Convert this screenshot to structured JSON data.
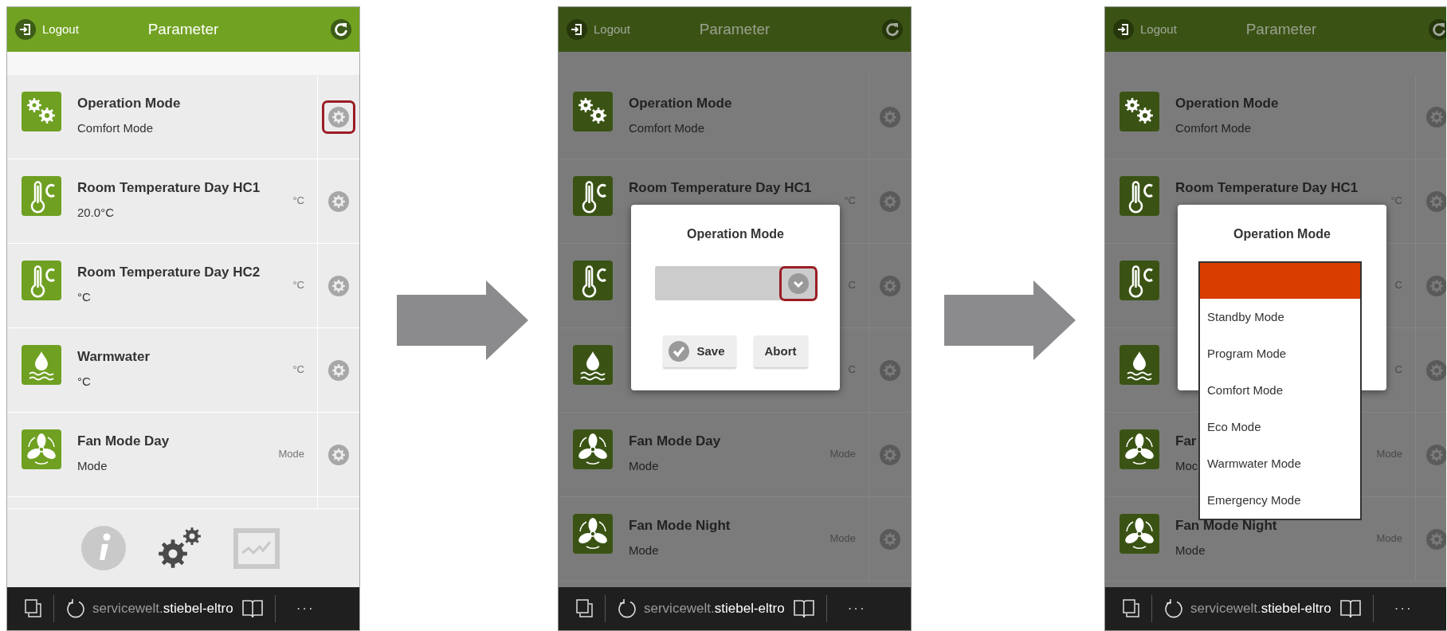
{
  "panels": [
    {
      "dimmed": false,
      "header": {
        "logout": "Logout",
        "title": "Parameter"
      },
      "rows": [
        {
          "kind": "gears",
          "title": "Operation Mode",
          "value": "Comfort Mode",
          "highlighted": true
        },
        {
          "kind": "thermometer",
          "title": "Room Temperature Day HC1",
          "value": "20.0°C",
          "unit": "°C",
          "highlighted": false
        },
        {
          "kind": "thermometer",
          "title": "Room Temperature Day HC2",
          "value": "°C",
          "unit": "°C",
          "highlighted": false
        },
        {
          "kind": "water",
          "title": "Warmwater",
          "value": "°C",
          "unit": "°C",
          "highlighted": false
        },
        {
          "kind": "fan",
          "title": "Fan Mode Day",
          "value": "Mode",
          "unit": "Mode",
          "highlighted": false
        },
        {
          "kind": "stub"
        }
      ],
      "footer_nav": [
        {
          "kind": "info",
          "selected": false
        },
        {
          "kind": "settings",
          "selected": true
        },
        {
          "kind": "chart",
          "selected": false
        }
      ],
      "browser_bar": {
        "url_host": "servicewelt.",
        "url_domain": "stiebel-eltro",
        "more": "···"
      }
    },
    {
      "dimmed": true,
      "header": {
        "logout": "Logout",
        "title": "Parameter"
      },
      "rows": [
        {
          "kind": "gears",
          "title": "Operation Mode",
          "value": "Comfort Mode",
          "highlighted": false
        },
        {
          "kind": "thermometer",
          "title": "Room Temperature Day HC1",
          "unit": "°C",
          "highlighted": false
        },
        {
          "kind": "thermometer",
          "unit": "C",
          "highlighted": false
        },
        {
          "kind": "water",
          "unit": "C",
          "highlighted": false
        },
        {
          "kind": "fan",
          "title": "Fan Mode Day",
          "value": "Mode",
          "unit": "Mode",
          "highlighted": false
        },
        {
          "kind": "fan",
          "title": "Fan Mode Night",
          "value": "Mode",
          "unit": "Mode",
          "highlighted": false
        }
      ],
      "dialog": {
        "title": "Operation Mode",
        "select": {
          "highlighted": true
        },
        "buttons": [
          {
            "kind": "save",
            "label": "Save"
          },
          {
            "kind": "abort",
            "label": "Abort"
          }
        ]
      },
      "browser_bar": {
        "url_host": "servicewelt.",
        "url_domain": "stiebel-eltro",
        "more": "···"
      }
    },
    {
      "dimmed": true,
      "header": {
        "logout": "Logout",
        "title": "Parameter"
      },
      "rows": [
        {
          "kind": "gears",
          "title": "Operation Mode",
          "value": "Comfort Mode",
          "highlighted": false
        },
        {
          "kind": "thermometer",
          "title": "Room Temperature Day HC1",
          "unit": "°C",
          "highlighted": false
        },
        {
          "kind": "thermometer",
          "unit": "C",
          "highlighted": false
        },
        {
          "kind": "water",
          "unit": "C",
          "highlighted": false
        },
        {
          "kind": "fan",
          "title": "Far",
          "value": "Moc",
          "unit": "Mode",
          "highlighted": false
        },
        {
          "kind": "fan",
          "title": "Fan Mode Night",
          "value": "Mode",
          "unit": "Mode",
          "highlighted": false
        }
      ],
      "dialog": {
        "title": "Operation Mode",
        "options": [
          {
            "selected": true
          },
          {
            "label": "Standby Mode",
            "selected": false
          },
          {
            "label": "Program Mode",
            "selected": false
          },
          {
            "label": "Comfort Mode",
            "selected": false
          },
          {
            "label": "Eco Mode",
            "selected": false
          },
          {
            "label": "Warmwater Mode",
            "selected": false
          },
          {
            "label": "Emergency Mode",
            "selected": false
          }
        ]
      },
      "browser_bar": {
        "url_host": "servicewelt.",
        "url_domain": "stiebel-eltro",
        "more": "···"
      }
    }
  ]
}
